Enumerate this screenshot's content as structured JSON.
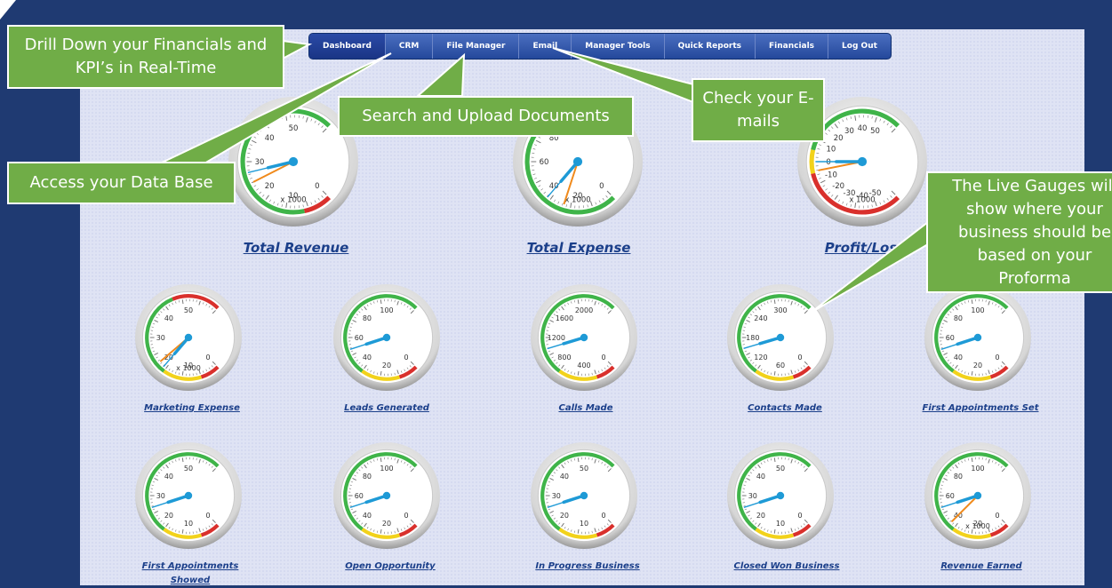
{
  "nav": {
    "items": [
      "Dashboard",
      "CRM",
      "File Manager",
      "Email",
      "Manager Tools",
      "Quick Reports",
      "Financials",
      "Log Out"
    ],
    "active": "Dashboard"
  },
  "colors": {
    "background": "#1f3a72",
    "callout": "#70ad47",
    "needle": "#1e9ad6",
    "ref_needle": "#f08a1c",
    "zone_red": "#d9302c",
    "zone_yellow": "#f2d21b",
    "zone_green": "#3fb449",
    "label": "#1b3f8a"
  },
  "gauges": [
    {
      "id": "total-revenue",
      "label": "Total Revenue",
      "size": "large",
      "ticks": [
        "0",
        "10",
        "20",
        "30",
        "40",
        "50"
      ],
      "unit": "x 1000",
      "min": 0,
      "max": 60,
      "value": 27,
      "ref_value": 24,
      "zones": [
        "red",
        "green"
      ]
    },
    {
      "id": "total-expense",
      "label": "Total Expense",
      "size": "large",
      "ticks": [
        "0",
        "20",
        "40",
        "60",
        "80",
        "100"
      ],
      "unit": "x 1000",
      "min": 0,
      "max": 120,
      "value": 38,
      "ref_value": 28,
      "zones": [
        "green",
        "red"
      ]
    },
    {
      "id": "profit-loss",
      "label": "Profit/Loss",
      "size": "large",
      "ticks": [
        "-50",
        "-40",
        "-30",
        "-20",
        "-10",
        "0",
        "10",
        "20",
        "30",
        "40",
        "50"
      ],
      "unit": "x 1000",
      "min": -60,
      "max": 60,
      "value": 0,
      "ref_value": -5,
      "zones": [
        "red",
        "yellow",
        "green"
      ]
    },
    {
      "id": "marketing-expense",
      "label": "Marketing Expense",
      "size": "small",
      "ticks": [
        "0",
        "10",
        "20",
        "30",
        "40",
        "50"
      ],
      "unit": "x 1000",
      "min": 0,
      "max": 60,
      "value": 19,
      "ref_value": 21,
      "zones": [
        "red",
        "yellow",
        "green",
        "red"
      ]
    },
    {
      "id": "leads-generated",
      "label": "Leads Generated",
      "size": "small",
      "ticks": [
        "0",
        "20",
        "40",
        "60",
        "80",
        "100"
      ],
      "unit": "",
      "min": 0,
      "max": 120,
      "value": 52,
      "zones": [
        "red",
        "yellow",
        "green"
      ]
    },
    {
      "id": "calls-made",
      "label": "Calls Made",
      "size": "small",
      "ticks": [
        "0",
        "400",
        "800",
        "1200",
        "1600",
        "2000"
      ],
      "unit": "",
      "min": 0,
      "max": 2400,
      "value": 1050,
      "zones": [
        "red",
        "yellow",
        "green"
      ]
    },
    {
      "id": "contacts-made",
      "label": "Contacts Made",
      "size": "small",
      "ticks": [
        "0",
        "60",
        "120",
        "180",
        "240",
        "300"
      ],
      "unit": "",
      "min": 0,
      "max": 360,
      "value": 158,
      "zones": [
        "red",
        "yellow",
        "green"
      ]
    },
    {
      "id": "first-appointments-set",
      "label": "First Appointments Set",
      "size": "small",
      "ticks": [
        "0",
        "20",
        "40",
        "60",
        "80",
        "100"
      ],
      "unit": "",
      "min": 0,
      "max": 120,
      "value": 52,
      "zones": [
        "red",
        "yellow",
        "green"
      ]
    },
    {
      "id": "first-appointments-showed",
      "label": "First Appointments Showed",
      "size": "small",
      "ticks": [
        "0",
        "10",
        "20",
        "30",
        "40",
        "50"
      ],
      "unit": "",
      "min": 0,
      "max": 60,
      "value": 26,
      "zones": [
        "red",
        "yellow",
        "green"
      ]
    },
    {
      "id": "open-opportunity",
      "label": "Open Opportunity",
      "size": "small",
      "ticks": [
        "0",
        "20",
        "40",
        "60",
        "80",
        "100"
      ],
      "unit": "",
      "min": 0,
      "max": 120,
      "value": 52,
      "zones": [
        "red",
        "yellow",
        "green"
      ]
    },
    {
      "id": "in-progress-business",
      "label": "In Progress Business",
      "size": "small",
      "ticks": [
        "0",
        "10",
        "20",
        "30",
        "40",
        "50"
      ],
      "unit": "",
      "min": 0,
      "max": 60,
      "value": 26,
      "zones": [
        "red",
        "yellow",
        "green"
      ]
    },
    {
      "id": "closed-won-business",
      "label": "Closed Won Business",
      "size": "small",
      "ticks": [
        "0",
        "10",
        "20",
        "30",
        "40",
        "50"
      ],
      "unit": "",
      "min": 0,
      "max": 60,
      "value": 26,
      "zones": [
        "red",
        "yellow",
        "green"
      ]
    },
    {
      "id": "revenue-earned",
      "label": "Revenue Earned",
      "size": "small",
      "ticks": [
        "0",
        "20",
        "40",
        "60",
        "80",
        "100"
      ],
      "unit": "x 1000",
      "min": 0,
      "max": 120,
      "value": 52,
      "ref_value": 40,
      "zones": [
        "red",
        "yellow",
        "green"
      ]
    }
  ],
  "callouts": {
    "drill_down": "Drill Down your Financials and KPI’s in Real-Time",
    "search_upload": "Search and Upload Documents",
    "check_email": "Check your E-mails",
    "database": "Access your Data Base",
    "live_gauges": "The Live Gauges will show where your business should be based on your Proforma"
  }
}
